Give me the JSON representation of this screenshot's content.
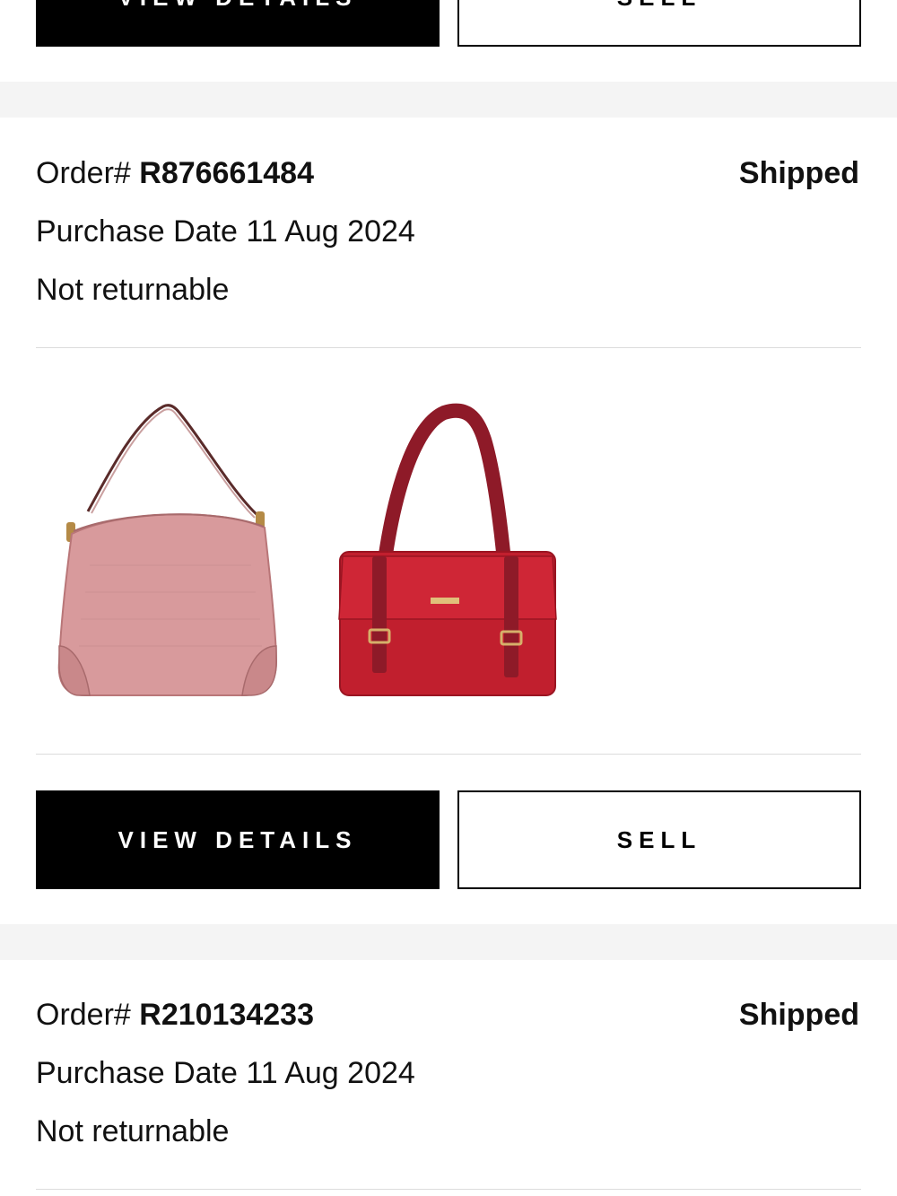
{
  "buttons": {
    "view_details": "VIEW DETAILS",
    "sell": "SELL"
  },
  "orders": [
    {
      "order_prefix": "Order# ",
      "order_number": "R876661484",
      "status": "Shipped",
      "purchase_date": "Purchase Date 11 Aug 2024",
      "return_policy": "Not returnable",
      "items": [
        {
          "color": "#d89a9c",
          "icon": "pink-hobo-bag-image"
        },
        {
          "color": "#c11f2e",
          "icon": "red-tote-bag-image"
        }
      ]
    },
    {
      "order_prefix": "Order# ",
      "order_number": "R210134233",
      "status": "Shipped",
      "purchase_date": "Purchase Date 11 Aug 2024",
      "return_policy": "Not returnable"
    }
  ],
  "colors": {
    "primary_button_bg": "#000000",
    "band_bg": "#f4f4f4",
    "divider": "#dcdcdc"
  }
}
